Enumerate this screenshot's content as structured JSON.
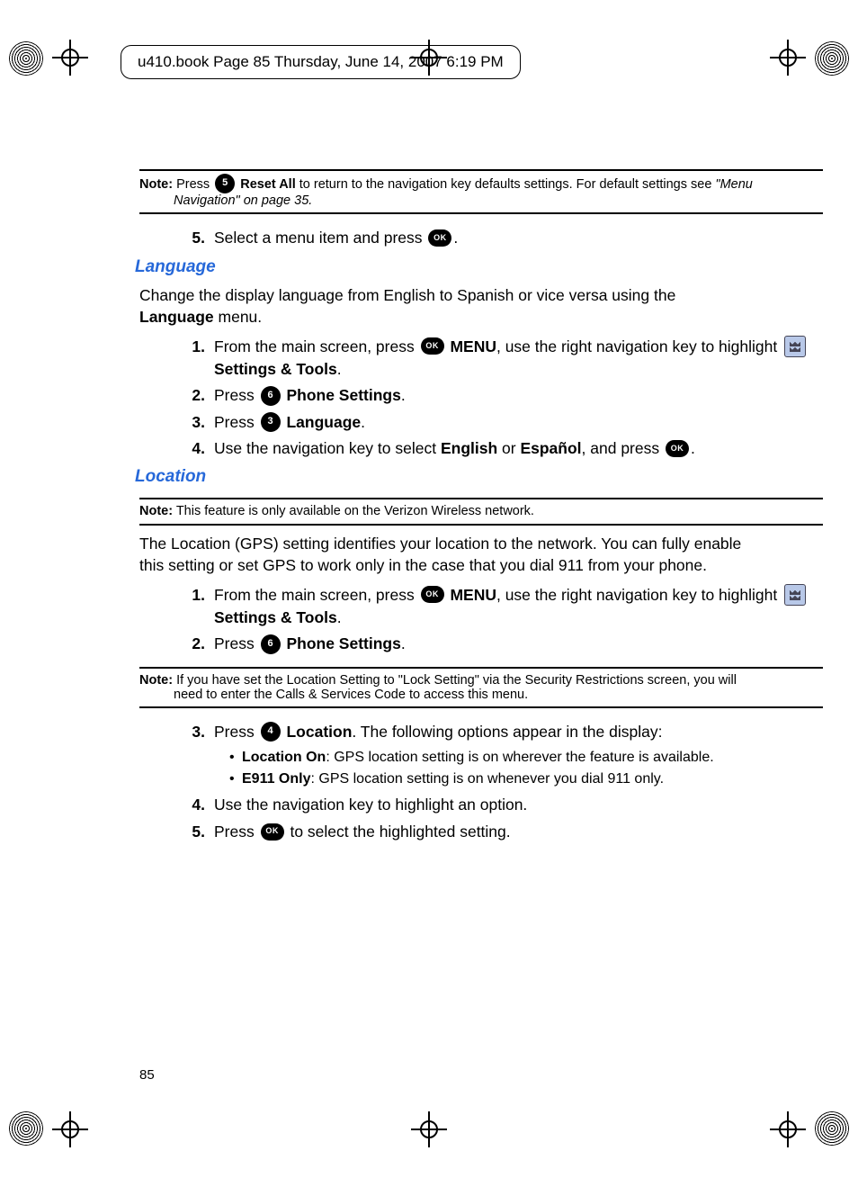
{
  "header": "u410.book  Page 85  Thursday, June 14, 2007  6:19 PM",
  "note1": {
    "label": "Note:",
    "line1_a": " Press ",
    "line1_b": " Reset All",
    "line1_c": " to return to the navigation key defaults settings. For default settings see ",
    "line1_d": "\"Menu",
    "line2": "Navigation\"  on page 35."
  },
  "step5_top": {
    "num": "5.",
    "a": "Select a menu item and press ",
    "b": "."
  },
  "heading_language": "Language",
  "lang_intro": {
    "a": "Change the display language from English to Spanish or vice versa using the ",
    "b": "Language",
    "c": " menu."
  },
  "lang_steps": {
    "s1": {
      "num": "1.",
      "a": "From the main screen, press ",
      "menu": " MENU",
      "b": ", use the right navigation key to highlight ",
      "st": " Settings & Tools",
      "c": "."
    },
    "s2": {
      "num": "2.",
      "a": "Press ",
      "label": " Phone Settings",
      "b": "."
    },
    "s3": {
      "num": "3.",
      "a": "Press ",
      "label": " Language",
      "b": "."
    },
    "s4": {
      "num": "4.",
      "a": "Use the navigation key to select ",
      "en": "English",
      "or": " or ",
      "es": "Español",
      "b": ", and press ",
      "c": "."
    }
  },
  "heading_location": "Location",
  "note2": {
    "label": "Note:",
    "text": " This feature is only available on the Verizon Wireless network."
  },
  "loc_intro": "The Location (GPS) setting identifies your location to the network. You can fully enable this setting or set GPS to work only in the case that you dial 911 from your phone.",
  "loc_steps_a": {
    "s1": {
      "num": "1.",
      "a": "From the main screen, press ",
      "menu": " MENU",
      "b": ", use the right navigation key to highlight ",
      "st": " Settings & Tools",
      "c": "."
    },
    "s2": {
      "num": "2.",
      "a": "Press ",
      "label": " Phone Settings",
      "b": "."
    }
  },
  "note3": {
    "label": "Note:",
    "line1": " If you have set the Location Setting to \"Lock Setting\" via the Security Restrictions screen, you will",
    "line2": "need to enter the Calls & Services Code to access this menu."
  },
  "loc_steps_b": {
    "s3": {
      "num": "3.",
      "a": "Press ",
      "label": " Location",
      "b": ". The following options appear in the display:"
    },
    "bullet1": {
      "t": "Location On",
      "d": ": GPS location setting is on wherever the feature is available."
    },
    "bullet2": {
      "t": "E911 Only",
      "d": ": GPS location setting is on whenever you dial 911 only."
    },
    "s4": {
      "num": "4.",
      "text": "Use the navigation key to highlight an option."
    },
    "s5": {
      "num": "5.",
      "a": "Press ",
      "b": " to select the highlighted setting."
    }
  },
  "icons": {
    "ok": "OK",
    "n5": "5",
    "n6": "6",
    "n3": "3",
    "n4": "4"
  },
  "page_number": "85"
}
